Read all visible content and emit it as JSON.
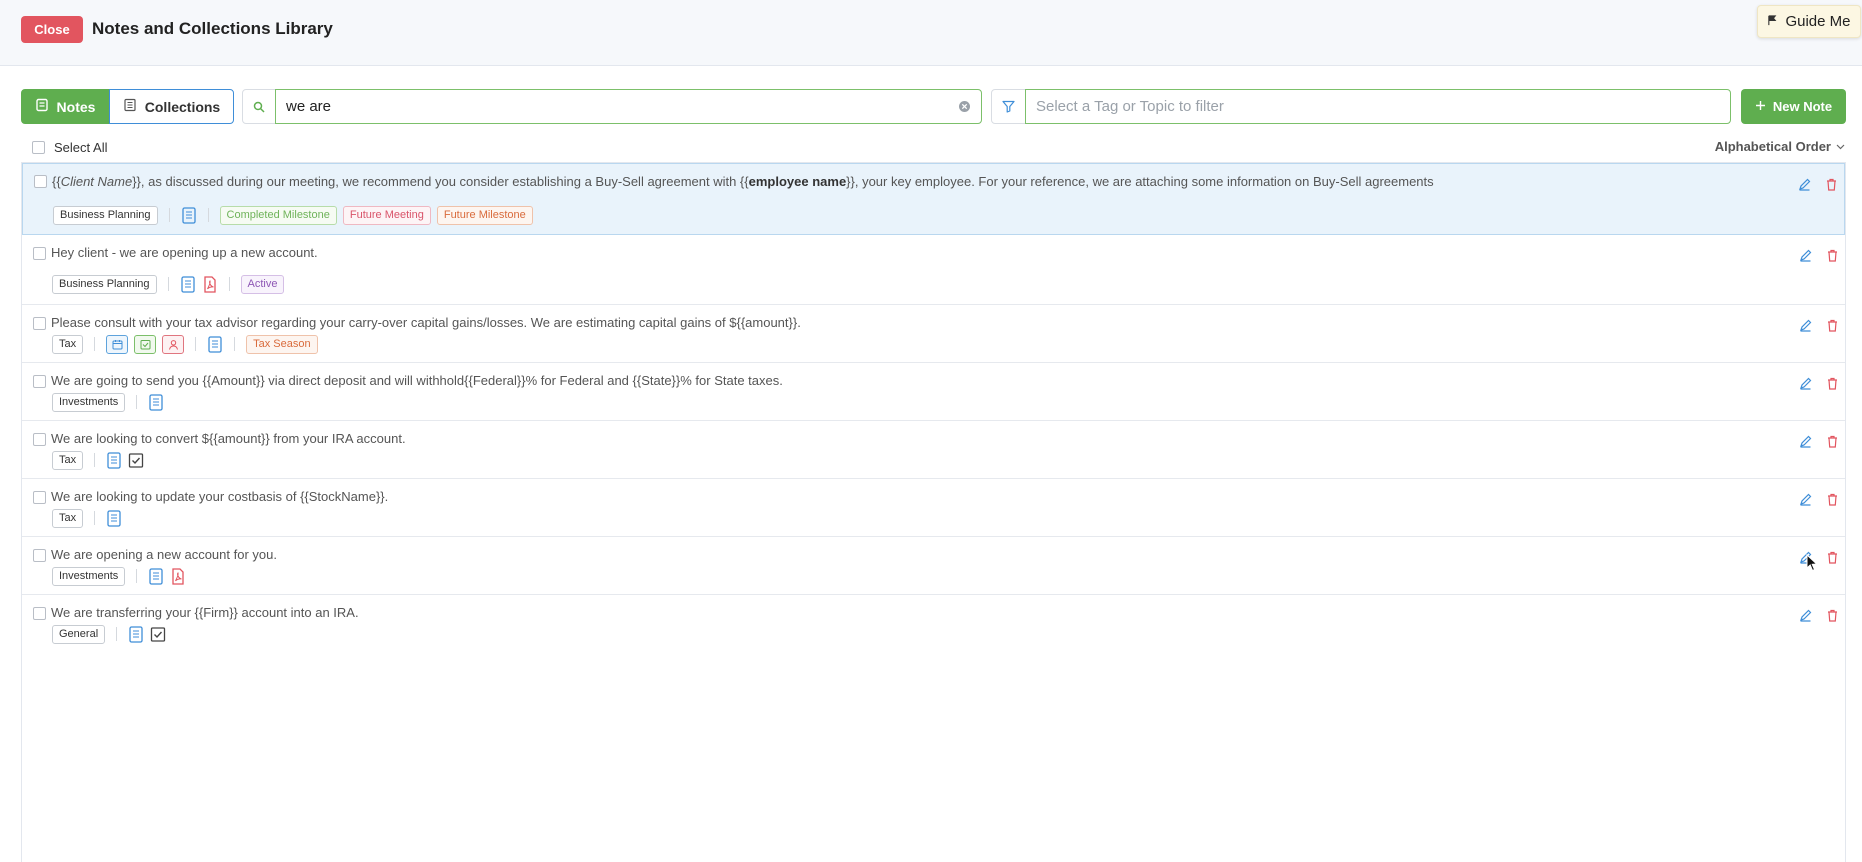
{
  "header": {
    "close_label": "Close",
    "title": "Notes and Collections Library",
    "guide_label": "Guide Me"
  },
  "toolbar": {
    "notes_tab": "Notes",
    "collections_tab": "Collections",
    "search_value": "we are",
    "filter_placeholder": "Select a Tag or Topic to filter",
    "new_note_label": "New Note"
  },
  "list_header": {
    "select_all": "Select All",
    "sort_label": "Alphabetical Order"
  },
  "notes": [
    {
      "segments": [
        {
          "text": "{{"
        },
        {
          "text": "Client Name",
          "style": "italic"
        },
        {
          "text": "}}, as discussed during our meeting, we recommend you consider establishing a Buy-Sell agreement with {{"
        },
        {
          "text": "employee name",
          "style": "bold"
        },
        {
          "text": "}}, your key employee. For your reference, we are attaching some information on Buy-Sell agreements"
        }
      ],
      "category": "Business Planning",
      "attachments": [
        "document-icon"
      ],
      "milestones": [
        {
          "label": "Completed Milestone",
          "color": "green"
        },
        {
          "label": "Future Meeting",
          "color": "pink"
        },
        {
          "label": "Future Milestone",
          "color": "orange"
        }
      ]
    },
    {
      "text": "Hey client - we are opening up a new account.",
      "category": "Business Planning",
      "attachments": [
        "document-icon",
        "pdf-icon"
      ],
      "milestones": [
        {
          "label": "Active",
          "color": "purple"
        }
      ]
    },
    {
      "text": "Please consult with your tax advisor regarding your carry-over capital gains/losses. We are estimating capital gains of ${{amount}}.",
      "category": "Tax",
      "action_icons": [
        "calendar-icon",
        "task-check-icon",
        "contact-icon"
      ],
      "attachments": [
        "document-icon"
      ],
      "milestones": [
        {
          "label": "Tax Season",
          "color": "orange"
        }
      ]
    },
    {
      "text": "We are going to send you {{Amount}} via direct deposit and will withhold{{Federal}}% for Federal and {{State}}% for State taxes.",
      "category": "Investments",
      "attachments": [
        "document-icon"
      ]
    },
    {
      "text": "We are looking to convert ${{amount}} from your IRA account.",
      "category": "Tax",
      "attachments": [
        "document-icon",
        "checkbox-icon"
      ]
    },
    {
      "text": "We are looking to update your costbasis of {{StockName}}.",
      "category": "Tax",
      "attachments": [
        "document-icon"
      ]
    },
    {
      "text": "We are opening a new account for you.",
      "category": "Investments",
      "attachments": [
        "document-icon",
        "pdf-icon"
      ]
    },
    {
      "text": "We are transferring your {{Firm}} account into an IRA.",
      "category": "General",
      "attachments": [
        "document-icon",
        "checkbox-icon"
      ]
    }
  ],
  "colors": {
    "accent_green": "#5fae4f",
    "danger_red": "#e2555f",
    "link_blue": "#3f8ed8"
  }
}
